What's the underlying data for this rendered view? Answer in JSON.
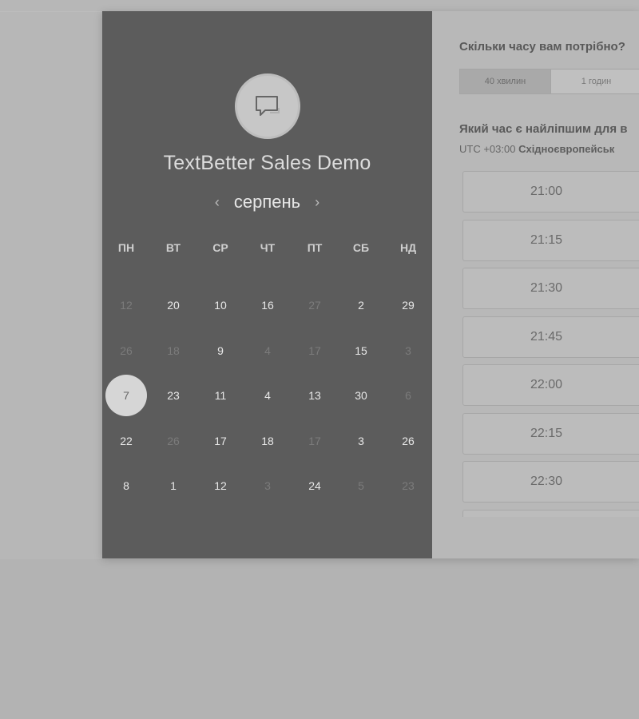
{
  "widget": {
    "title": "TextBetter Sales Demo",
    "avatar_icon": "chat-bubble-icon",
    "month": "серпень",
    "prev_icon": "‹",
    "next_icon": "›"
  },
  "calendar": {
    "weekdays": [
      "ПН",
      "ВТ",
      "СР",
      "ЧТ",
      "ПТ",
      "СБ",
      "НД"
    ],
    "weeks": [
      [
        {
          "d": "12",
          "s": "muted"
        },
        {
          "d": "20",
          "s": "active"
        },
        {
          "d": "10",
          "s": "active"
        },
        {
          "d": "16",
          "s": "active"
        },
        {
          "d": "27",
          "s": "muted"
        },
        {
          "d": "2",
          "s": "active"
        },
        {
          "d": "29",
          "s": "active"
        }
      ],
      [
        {
          "d": "26",
          "s": "muted"
        },
        {
          "d": "18",
          "s": "muted"
        },
        {
          "d": "9",
          "s": "active"
        },
        {
          "d": "4",
          "s": "muted"
        },
        {
          "d": "17",
          "s": "muted"
        },
        {
          "d": "15",
          "s": "active"
        },
        {
          "d": "3",
          "s": "muted"
        }
      ],
      [
        {
          "d": "7",
          "s": "selected"
        },
        {
          "d": "23",
          "s": "active"
        },
        {
          "d": "11",
          "s": "active"
        },
        {
          "d": "4",
          "s": "active"
        },
        {
          "d": "13",
          "s": "active"
        },
        {
          "d": "30",
          "s": "active"
        },
        {
          "d": "6",
          "s": "muted"
        }
      ],
      [
        {
          "d": "22",
          "s": "active"
        },
        {
          "d": "26",
          "s": "muted"
        },
        {
          "d": "17",
          "s": "active"
        },
        {
          "d": "18",
          "s": "active"
        },
        {
          "d": "17",
          "s": "muted"
        },
        {
          "d": "3",
          "s": "active"
        },
        {
          "d": "26",
          "s": "active"
        }
      ],
      [
        {
          "d": "8",
          "s": "active"
        },
        {
          "d": "1",
          "s": "active"
        },
        {
          "d": "12",
          "s": "active"
        },
        {
          "d": "3",
          "s": "muted"
        },
        {
          "d": "24",
          "s": "active"
        },
        {
          "d": "5",
          "s": "muted"
        },
        {
          "d": "23",
          "s": "muted"
        }
      ]
    ]
  },
  "right": {
    "duration_question": "Скільки часу вам потрібно?",
    "durations": [
      {
        "label": "40 хвилин",
        "selected": true
      },
      {
        "label": "1 годин",
        "selected": false
      }
    ],
    "time_question": "Який час є найліпшим для в",
    "timezone_prefix": "UTC +03:00",
    "timezone_name": "Східноєвропейськ",
    "slots": [
      "21:00",
      "21:15",
      "21:30",
      "21:45",
      "22:00",
      "22:15",
      "22:30",
      ""
    ]
  },
  "colors": {
    "left_panel": "#5c5c5c",
    "page_bg": "#b3b3b3",
    "selected_day": "#d6d6d6"
  }
}
